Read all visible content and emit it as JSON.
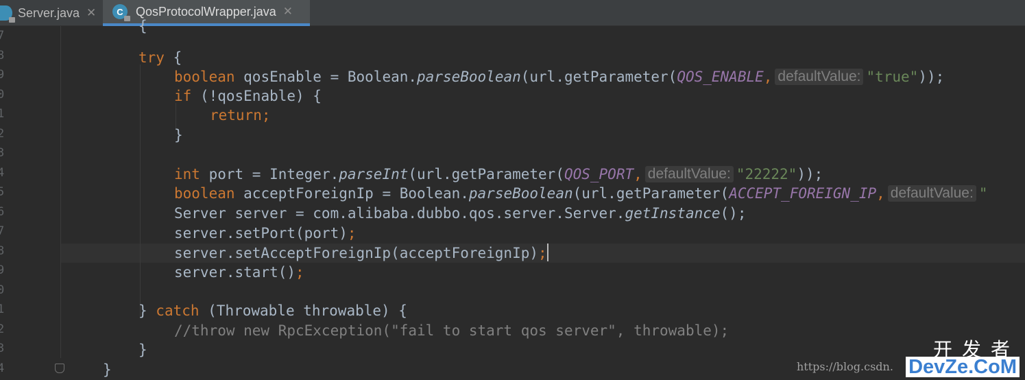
{
  "tabs": [
    {
      "label": "Server.java",
      "active": false,
      "icon": "class-file-icon"
    },
    {
      "label": "QosProtocolWrapper.java",
      "active": true,
      "icon": "class-file-icon"
    }
  ],
  "line_numbers": [
    "7",
    "8",
    "9",
    "0",
    "1",
    "2",
    "3",
    "4",
    "5",
    "6",
    "7",
    "8",
    "9",
    "0",
    "1",
    "2",
    "3",
    "4"
  ],
  "code": {
    "l0": "{",
    "try_kw": "try",
    "try_rest": " {",
    "l2_kw": "boolean",
    "l2_a": " qosEnable = Boolean.",
    "l2_m": "parseBoolean",
    "l2_b": "(url.getParameter(",
    "l2_f": "QOS_ENABLE",
    "l2_comma": ",",
    "l2_hint": "defaultValue:",
    "l2_s": "\"true\"",
    "l2_end": "));",
    "l3_kw": "if",
    "l3_rest": " (!qosEnable) {",
    "l4_kw": "return;",
    "l5": "}",
    "l7_kw": "int",
    "l7_a": " port = Integer.",
    "l7_m": "parseInt",
    "l7_b": "(url.getParameter(",
    "l7_f": "QOS_PORT",
    "l7_comma": ",",
    "l7_hint": "defaultValue:",
    "l7_s": "\"22222\"",
    "l7_end": "));",
    "l8_kw": "boolean",
    "l8_a": " acceptForeignIp = Boolean.",
    "l8_m": "parseBoolean",
    "l8_b": "(url.getParameter(",
    "l8_f": "ACCEPT_FOREIGN_IP",
    "l8_comma": ",",
    "l8_hint": "defaultValue:",
    "l8_s": "\"",
    "l9_a": "Server server = com.alibaba.dubbo.qos.server.Server.",
    "l9_m": "getInstance",
    "l9_end": "();",
    "l10_a": "server.setPort(port)",
    "l10_semi": ";",
    "l11_a": "server.setAcceptForeignIp(acceptForeignIp)",
    "l11_semi": ";",
    "l12_a": "server.start()",
    "l12_semi": ";",
    "l14_a": "} ",
    "l14_kw": "catch",
    "l14_b": " (Throwable throwable) {",
    "l15": "//throw new RpcException(\"fail to start qos server\", throwable);",
    "l16": "}",
    "l17": "}"
  },
  "watermark": {
    "url": "https://blog.csdn.",
    "cn": "开发者",
    "en": "DevZe.CoM"
  }
}
